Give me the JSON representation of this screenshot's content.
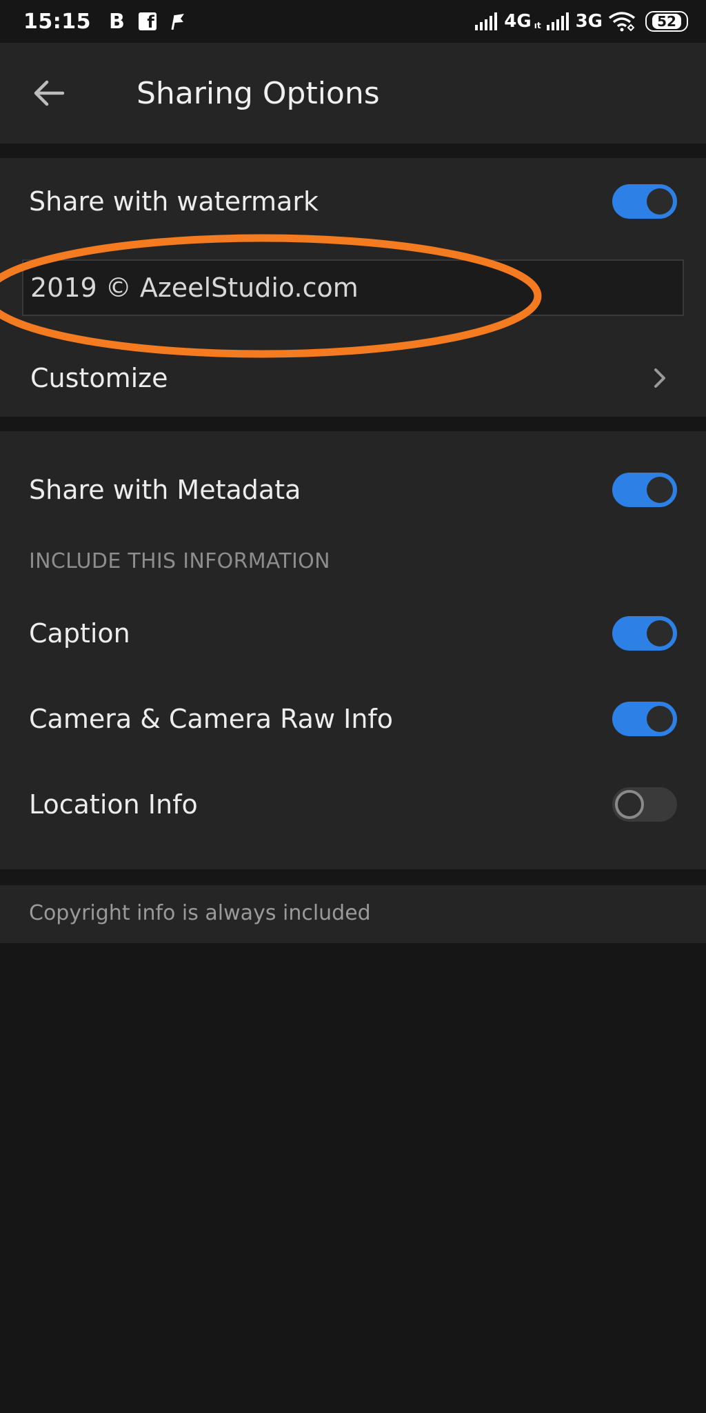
{
  "status_bar": {
    "time": "15:15",
    "b_label": "B",
    "fb_label": "f",
    "net1": "4G",
    "net1_sub": "ıt",
    "net2": "3G",
    "battery": "52"
  },
  "header": {
    "back_icon": "arrow-left-icon",
    "title": "Sharing Options"
  },
  "watermark": {
    "toggle_label": "Share with watermark",
    "enabled": true,
    "text_value": "2019 © AzeelStudio.com",
    "highlight_color": "#f47b20",
    "customize_label": "Customize",
    "customize_icon": "chevron-right-icon"
  },
  "metadata": {
    "toggle_label": "Share with Metadata",
    "enabled": true,
    "section_caption": "INCLUDE THIS INFORMATION",
    "items": [
      {
        "label": "Caption",
        "enabled": true
      },
      {
        "label": "Camera & Camera Raw Info",
        "enabled": true
      },
      {
        "label": "Location Info",
        "enabled": false
      }
    ]
  },
  "footer_note": "Copyright info is always included",
  "colors": {
    "accent": "#2d81e6",
    "background": "#161616",
    "panel": "#252525"
  }
}
